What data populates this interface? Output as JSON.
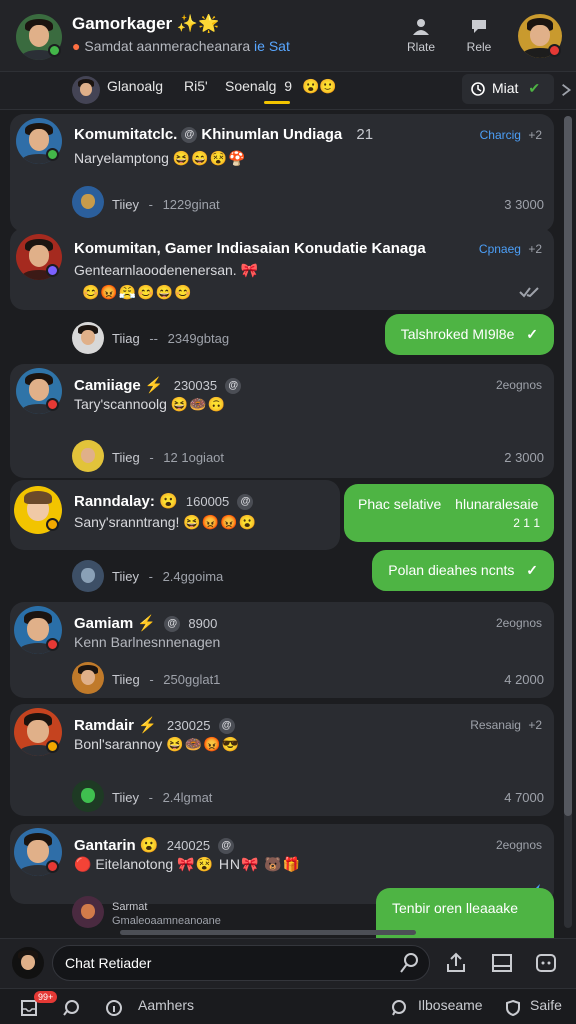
{
  "header": {
    "title": "Gamorkager",
    "title_emoji": "✨🌟",
    "subtitle": "Samdat aanmeracheanara",
    "subtitle_link": "ie Sat",
    "btn_1_label": "Rlate",
    "btn_2_label": "Rele"
  },
  "tabs": {
    "tab_1": "Glanoalg",
    "tab_2": "Ri5'",
    "tab_3": "Soenalg",
    "tab_3_count": "9",
    "tab_3_emoji": "😮🙂",
    "mat_label": "Miat",
    "mat_icon": "✔"
  },
  "feed": {
    "cards": [
      {
        "name": "Komumitatclc.",
        "badge": "@",
        "name_extra": "Khinumlan Undiaga",
        "name_num": "21",
        "meta": "Charcig",
        "meta_num": "+2",
        "text": "Naryelamptong",
        "emojis": "😆😄😵🍄"
      },
      {
        "name": "Komumitan, Gamer Indiasaian Konudatie Kanaga",
        "meta": "Cpnaeg",
        "meta_num": "+2",
        "text": "Gentearnlaoodenenersan.",
        "text_emoji": "🎀",
        "emojis": "😊😡😤😊😄😊"
      },
      {
        "name": "Camiiage ⚡",
        "num": "230035",
        "badge": "@",
        "meta": "2eognos",
        "text": "Tary'scannoolg",
        "emojis": "😆🍩🙃"
      },
      {
        "name": "Ranndalay:",
        "num_emoji": "😮",
        "num": "160005",
        "badge": "@",
        "text": "Sany'sranntrang!",
        "emojis": "😆😡😡😮"
      },
      {
        "name": "Gamiam",
        "name_emoji": "⚡",
        "badge": "@",
        "num": "8900",
        "meta": "2eognos",
        "text": "Kenn Barlnesnnenagen"
      },
      {
        "name": "Ramdair ⚡",
        "num": "230025",
        "badge": "@",
        "meta": "Resanaig",
        "meta_num": "+2",
        "text": "Bonl'sarannoy",
        "emojis": "😆🍩😡😎"
      },
      {
        "name": "Gantarin",
        "name_emoji": "😮",
        "num": "240025",
        "badge": "@",
        "meta": "2eognos",
        "text": "Eitelanotong",
        "emojis": "🎀😵 HN🎀 🐻🎁"
      }
    ],
    "sub_rows": [
      {
        "name": "Tiiey",
        "sep": "-",
        "date": "1229ginat",
        "time": "3 3000"
      },
      {
        "name": "Tiiag",
        "sep": "--",
        "date": "2349gbtag"
      },
      {
        "name": "Tiieg",
        "sep": "-",
        "date": "12 1ogiaot",
        "time": "2 3000"
      },
      {
        "name": "Tiiey",
        "sep": "-",
        "date": "2.4ggoima"
      },
      {
        "name": "Tiieg",
        "sep": "-",
        "date": "250gglat1",
        "time": "4 2000"
      },
      {
        "name": "Tiiey",
        "sep": "-",
        "date": "2.4lgmat",
        "time": "4 7000"
      },
      {
        "name": "Sarmat",
        "date": "Gmaleoaamneanoane"
      }
    ],
    "bubbles": [
      {
        "text": "Talshroked MI9l8e",
        "tick": "✓"
      },
      {
        "text": "Phac selative",
        "text_2": "hlunaralesaie",
        "sub": "2 1 1"
      },
      {
        "text": "Polan dieahes ncnts",
        "tick": "✓"
      },
      {
        "text": "Tenbir oren lleaaake"
      }
    ]
  },
  "composer": {
    "placeholder": "Chat Retiader"
  },
  "bottom_nav": {
    "badge": "99+",
    "item_1": "Aamhers",
    "item_2": "Ilboseame",
    "item_3": "Saife"
  },
  "colors": {
    "accent_green": "#4eb444",
    "link_blue": "#4c9ff7",
    "tab_underline": "#f2c400",
    "online": "#43b649",
    "busy": "#e53935",
    "away": "#f2a900"
  }
}
